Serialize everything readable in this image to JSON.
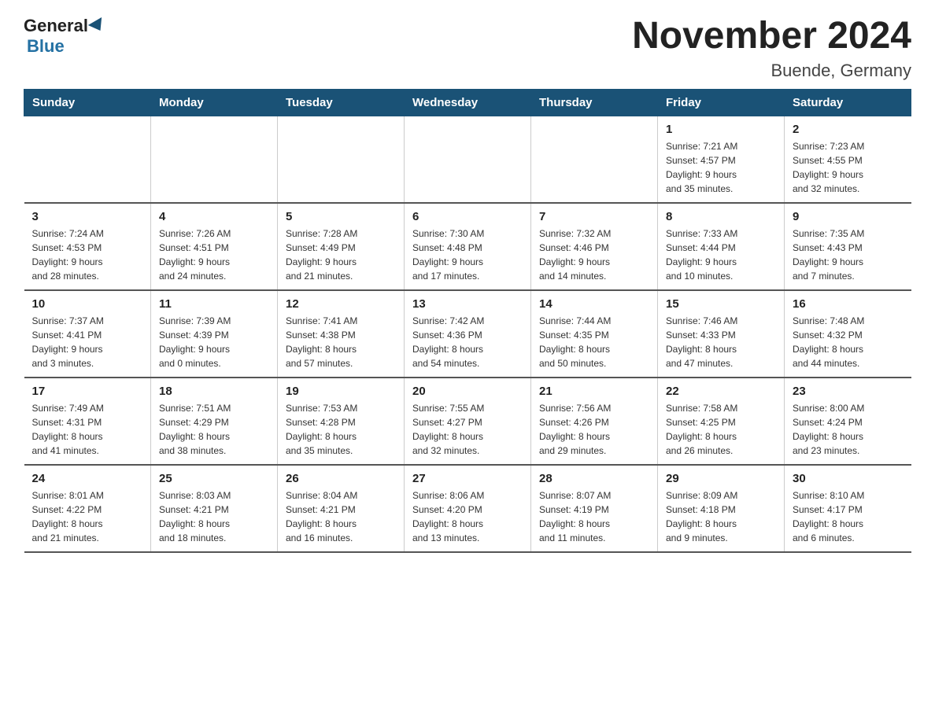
{
  "logo": {
    "general": "General",
    "blue": "Blue"
  },
  "title": "November 2024",
  "subtitle": "Buende, Germany",
  "days": [
    "Sunday",
    "Monday",
    "Tuesday",
    "Wednesday",
    "Thursday",
    "Friday",
    "Saturday"
  ],
  "weeks": [
    [
      {
        "day": "",
        "info": ""
      },
      {
        "day": "",
        "info": ""
      },
      {
        "day": "",
        "info": ""
      },
      {
        "day": "",
        "info": ""
      },
      {
        "day": "",
        "info": ""
      },
      {
        "day": "1",
        "info": "Sunrise: 7:21 AM\nSunset: 4:57 PM\nDaylight: 9 hours\nand 35 minutes."
      },
      {
        "day": "2",
        "info": "Sunrise: 7:23 AM\nSunset: 4:55 PM\nDaylight: 9 hours\nand 32 minutes."
      }
    ],
    [
      {
        "day": "3",
        "info": "Sunrise: 7:24 AM\nSunset: 4:53 PM\nDaylight: 9 hours\nand 28 minutes."
      },
      {
        "day": "4",
        "info": "Sunrise: 7:26 AM\nSunset: 4:51 PM\nDaylight: 9 hours\nand 24 minutes."
      },
      {
        "day": "5",
        "info": "Sunrise: 7:28 AM\nSunset: 4:49 PM\nDaylight: 9 hours\nand 21 minutes."
      },
      {
        "day": "6",
        "info": "Sunrise: 7:30 AM\nSunset: 4:48 PM\nDaylight: 9 hours\nand 17 minutes."
      },
      {
        "day": "7",
        "info": "Sunrise: 7:32 AM\nSunset: 4:46 PM\nDaylight: 9 hours\nand 14 minutes."
      },
      {
        "day": "8",
        "info": "Sunrise: 7:33 AM\nSunset: 4:44 PM\nDaylight: 9 hours\nand 10 minutes."
      },
      {
        "day": "9",
        "info": "Sunrise: 7:35 AM\nSunset: 4:43 PM\nDaylight: 9 hours\nand 7 minutes."
      }
    ],
    [
      {
        "day": "10",
        "info": "Sunrise: 7:37 AM\nSunset: 4:41 PM\nDaylight: 9 hours\nand 3 minutes."
      },
      {
        "day": "11",
        "info": "Sunrise: 7:39 AM\nSunset: 4:39 PM\nDaylight: 9 hours\nand 0 minutes."
      },
      {
        "day": "12",
        "info": "Sunrise: 7:41 AM\nSunset: 4:38 PM\nDaylight: 8 hours\nand 57 minutes."
      },
      {
        "day": "13",
        "info": "Sunrise: 7:42 AM\nSunset: 4:36 PM\nDaylight: 8 hours\nand 54 minutes."
      },
      {
        "day": "14",
        "info": "Sunrise: 7:44 AM\nSunset: 4:35 PM\nDaylight: 8 hours\nand 50 minutes."
      },
      {
        "day": "15",
        "info": "Sunrise: 7:46 AM\nSunset: 4:33 PM\nDaylight: 8 hours\nand 47 minutes."
      },
      {
        "day": "16",
        "info": "Sunrise: 7:48 AM\nSunset: 4:32 PM\nDaylight: 8 hours\nand 44 minutes."
      }
    ],
    [
      {
        "day": "17",
        "info": "Sunrise: 7:49 AM\nSunset: 4:31 PM\nDaylight: 8 hours\nand 41 minutes."
      },
      {
        "day": "18",
        "info": "Sunrise: 7:51 AM\nSunset: 4:29 PM\nDaylight: 8 hours\nand 38 minutes."
      },
      {
        "day": "19",
        "info": "Sunrise: 7:53 AM\nSunset: 4:28 PM\nDaylight: 8 hours\nand 35 minutes."
      },
      {
        "day": "20",
        "info": "Sunrise: 7:55 AM\nSunset: 4:27 PM\nDaylight: 8 hours\nand 32 minutes."
      },
      {
        "day": "21",
        "info": "Sunrise: 7:56 AM\nSunset: 4:26 PM\nDaylight: 8 hours\nand 29 minutes."
      },
      {
        "day": "22",
        "info": "Sunrise: 7:58 AM\nSunset: 4:25 PM\nDaylight: 8 hours\nand 26 minutes."
      },
      {
        "day": "23",
        "info": "Sunrise: 8:00 AM\nSunset: 4:24 PM\nDaylight: 8 hours\nand 23 minutes."
      }
    ],
    [
      {
        "day": "24",
        "info": "Sunrise: 8:01 AM\nSunset: 4:22 PM\nDaylight: 8 hours\nand 21 minutes."
      },
      {
        "day": "25",
        "info": "Sunrise: 8:03 AM\nSunset: 4:21 PM\nDaylight: 8 hours\nand 18 minutes."
      },
      {
        "day": "26",
        "info": "Sunrise: 8:04 AM\nSunset: 4:21 PM\nDaylight: 8 hours\nand 16 minutes."
      },
      {
        "day": "27",
        "info": "Sunrise: 8:06 AM\nSunset: 4:20 PM\nDaylight: 8 hours\nand 13 minutes."
      },
      {
        "day": "28",
        "info": "Sunrise: 8:07 AM\nSunset: 4:19 PM\nDaylight: 8 hours\nand 11 minutes."
      },
      {
        "day": "29",
        "info": "Sunrise: 8:09 AM\nSunset: 4:18 PM\nDaylight: 8 hours\nand 9 minutes."
      },
      {
        "day": "30",
        "info": "Sunrise: 8:10 AM\nSunset: 4:17 PM\nDaylight: 8 hours\nand 6 minutes."
      }
    ]
  ]
}
